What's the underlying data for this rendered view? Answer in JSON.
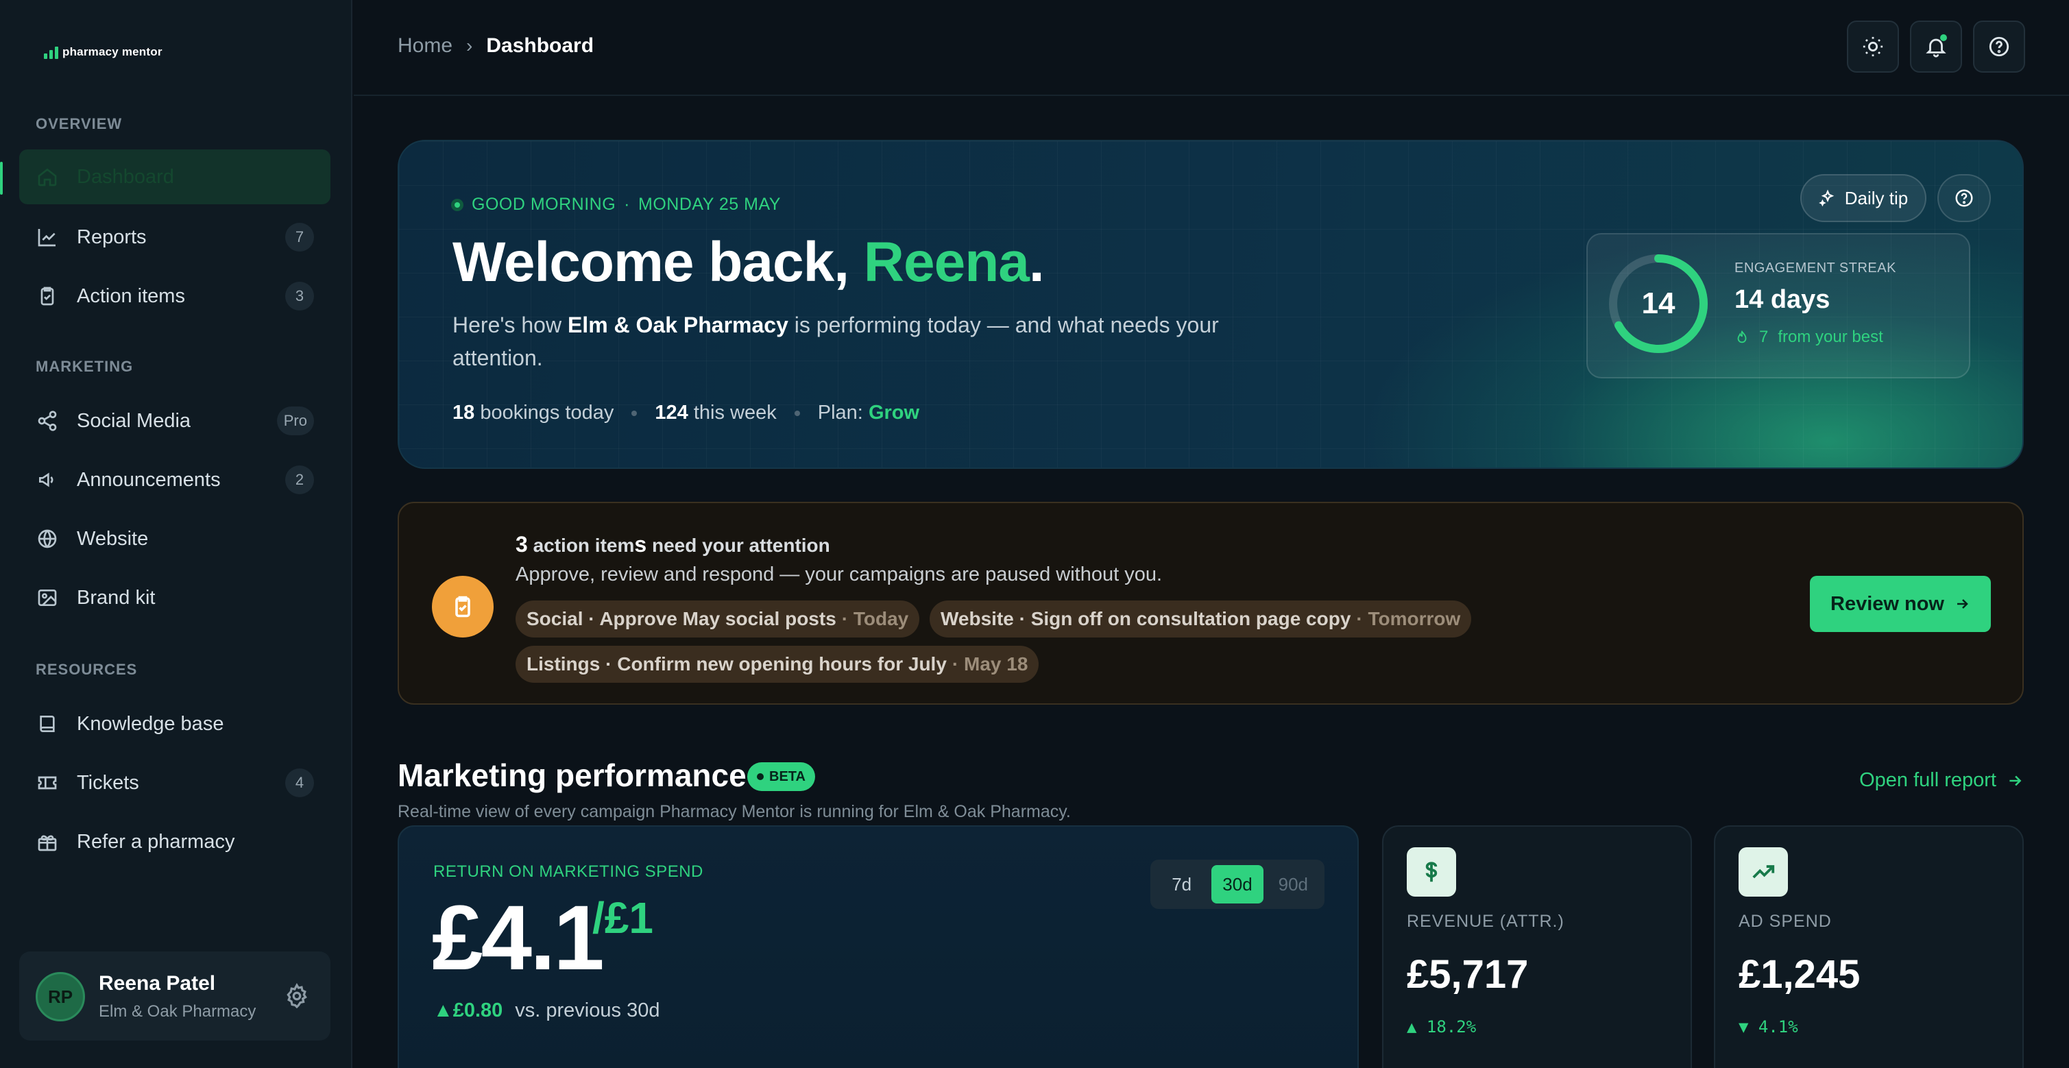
{
  "brand": {
    "name": "pharmacy mentor",
    "accent": "#2fd27f"
  },
  "sidebar": {
    "sections": [
      "OVERVIEW",
      "MARKETING",
      "RESOURCES"
    ],
    "items": [
      {
        "label": "Dashboard",
        "icon": "home-icon",
        "badge": ""
      },
      {
        "label": "Reports",
        "icon": "chart-line-icon",
        "badge": "7"
      },
      {
        "label": "Action items",
        "icon": "clipboard-check-icon",
        "badge": "3"
      },
      {
        "label": "Social Media",
        "icon": "share-icon",
        "badge": "Pro"
      },
      {
        "label": "Announcements",
        "icon": "megaphone-icon",
        "badge": "2"
      },
      {
        "label": "Website",
        "icon": "globe-icon",
        "badge": ""
      },
      {
        "label": "Brand kit",
        "icon": "image-icon",
        "badge": ""
      },
      {
        "label": "Knowledge base",
        "icon": "book-icon",
        "badge": ""
      },
      {
        "label": "Tickets",
        "icon": "ticket-icon",
        "badge": "4"
      },
      {
        "label": "Refer a pharmacy",
        "icon": "gift-icon",
        "badge": ""
      }
    ],
    "user": {
      "initials": "RP",
      "name": "Reena Patel",
      "org": "Elm & Oak Pharmacy"
    }
  },
  "header": {
    "breadcrumb_home": "Home",
    "breadcrumb_current": "Dashboard",
    "buttons": [
      "sun-icon",
      "bell-icon",
      "help-icon"
    ]
  },
  "hero": {
    "greeting": "GOOD MORNING",
    "date": "MONDAY 25 MAY",
    "title_prefix": "Welcome back, ",
    "title_name": "Reena",
    "title_suffix": ".",
    "sub_1": "Here's how ",
    "sub_pharmacy": "Elm & Oak Pharmacy",
    "sub_2": " is performing today — and what needs your attention.",
    "bookings_today_num": "18",
    "bookings_today_text": " bookings today",
    "week_num": "124",
    "week_text": " this week",
    "plan_label": "Plan: ",
    "plan_value": "Grow",
    "tip_label": "Daily tip",
    "streak": {
      "label": "ENGAGEMENT STREAK",
      "number": "14",
      "value": "14 days",
      "best_num": "7",
      "best_text": "from your best",
      "progress": 0.67
    }
  },
  "actions": {
    "count": "3",
    "title_a": " action item",
    "title_b": "s",
    "title_c": " need your attention",
    "subtitle": "Approve, review and respond — your campaigns are paused without you.",
    "chips": [
      {
        "text": "Social · Approve May social posts",
        "when": "· Today"
      },
      {
        "text": "Website · Sign off on consultation page copy",
        "when": "· Tomorrow"
      },
      {
        "text": "Listings · Confirm new opening hours for July",
        "when": "· May 18"
      }
    ],
    "button": "Review now"
  },
  "performance": {
    "title": "Marketing performance",
    "badge": "BETA",
    "subtitle": "Real-time view of every campaign Pharmacy Mentor is running for Elm & Oak Pharmacy.",
    "full_report": "Open full report",
    "roms": {
      "label": "RETURN ON MARKETING SPEND",
      "value": "£4.1",
      "unit": "/£1",
      "delta": "▲£0.80",
      "delta_text": "vs. previous 30d",
      "ranges": [
        "7d",
        "30d",
        "90d"
      ],
      "selected_range": "30d"
    },
    "metrics": [
      {
        "label": "REVENUE (ATTR.)",
        "value": "£5,717",
        "change": "▲ 18.2%",
        "icon": "dollar-icon"
      },
      {
        "label": "AD SPEND",
        "value": "£1,245",
        "change": "▼ 4.1%",
        "icon": "trending-up-icon"
      }
    ]
  }
}
